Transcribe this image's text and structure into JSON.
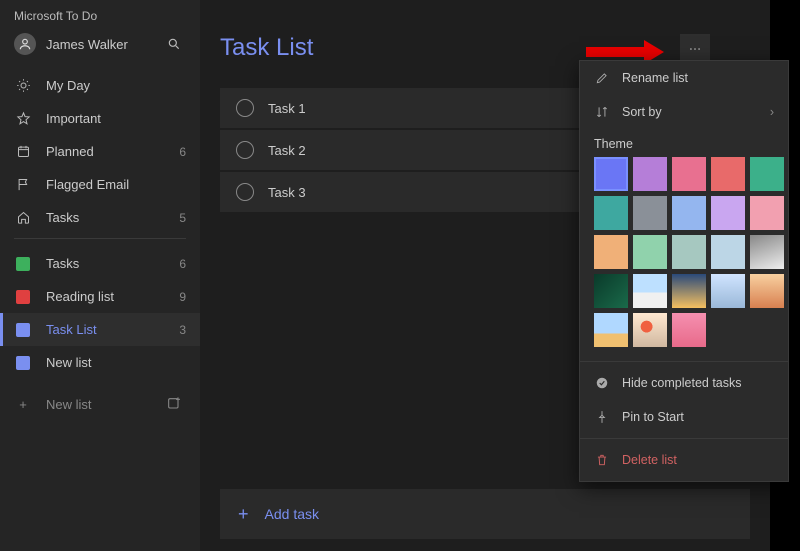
{
  "app_title": "Microsoft To Do",
  "user_name": "James Walker",
  "window_controls": {
    "min": "—",
    "max": "▢",
    "close": "✕"
  },
  "sidebar": {
    "smart": [
      {
        "icon": "sun",
        "label": "My Day",
        "count": ""
      },
      {
        "icon": "star",
        "label": "Important",
        "count": ""
      },
      {
        "icon": "calendar",
        "label": "Planned",
        "count": "6"
      },
      {
        "icon": "flag",
        "label": "Flagged Email",
        "count": ""
      },
      {
        "icon": "home",
        "label": "Tasks",
        "count": "5"
      }
    ],
    "lists": [
      {
        "color": "#3db05d",
        "label": "Tasks",
        "count": "6",
        "selected": false
      },
      {
        "color": "#e04040",
        "label": "Reading list",
        "count": "9",
        "selected": false
      },
      {
        "color": "#7a8ff0",
        "label": "Task List",
        "count": "3",
        "selected": true
      },
      {
        "color": "#7a8ff0",
        "label": "New list",
        "count": "",
        "selected": false
      }
    ],
    "new_list_label": "New list"
  },
  "main": {
    "title": "Task List",
    "tasks": [
      {
        "title": "Task 1"
      },
      {
        "title": "Task 2"
      },
      {
        "title": "Task 3"
      }
    ],
    "add_task_label": "Add task"
  },
  "menu": {
    "rename_label": "Rename list",
    "sort_label": "Sort by",
    "theme_label": "Theme",
    "hide_label": "Hide completed tasks",
    "pin_label": "Pin to Start",
    "delete_label": "Delete list",
    "theme_colors": [
      "#6a76f5",
      "#b57ed8",
      "#e87090",
      "#e86a6a",
      "#3cb08a",
      "#3ea8a0",
      "#8a9098",
      "#94b6ef",
      "#c9a6f0",
      "#f2a0b0",
      "#f0b078",
      "#90d2ac",
      "#a6c8c0",
      "#bcd6e6"
    ],
    "theme_photos": 8
  }
}
